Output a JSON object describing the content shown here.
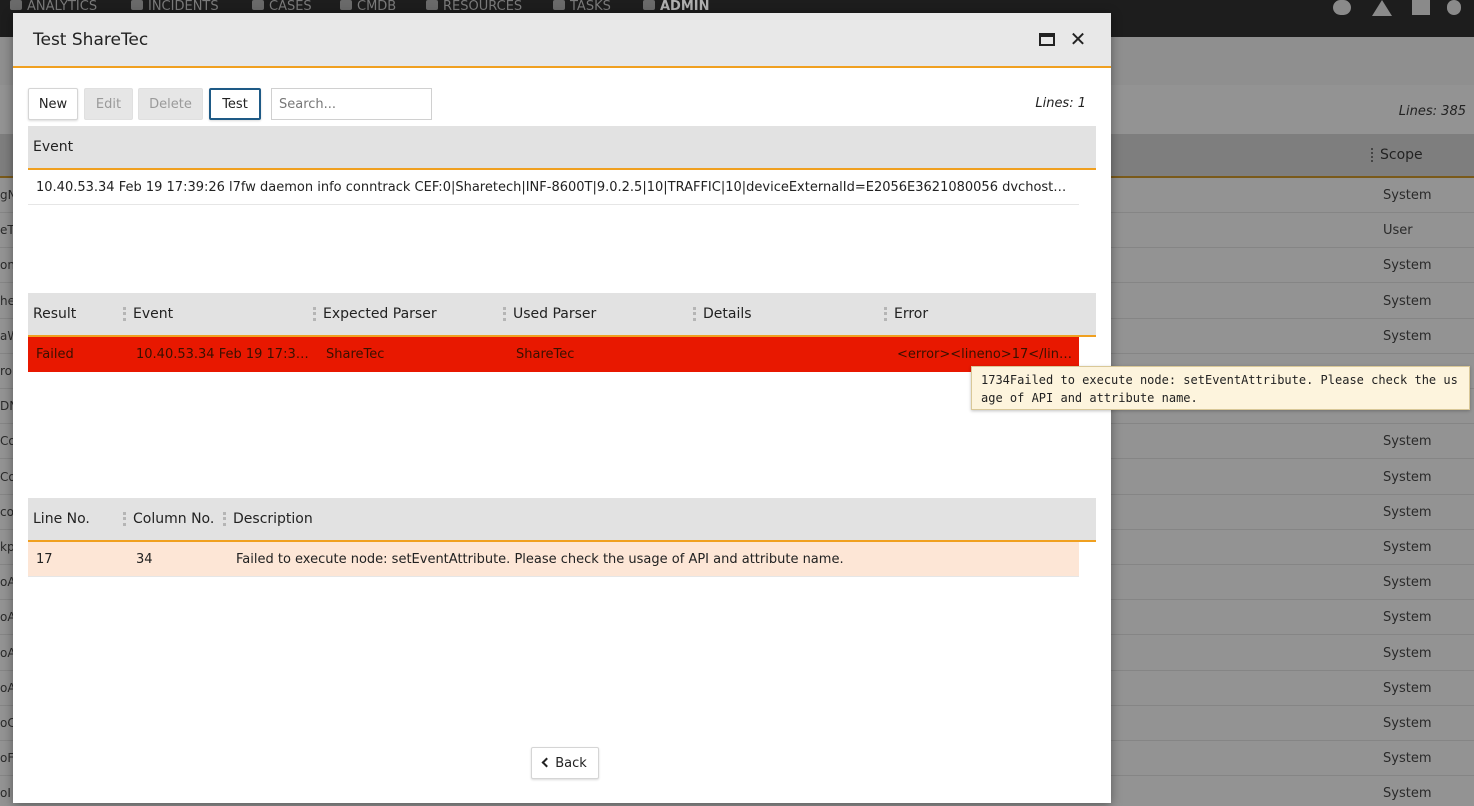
{
  "background": {
    "nav": [
      {
        "label": "ANALYTICS",
        "icon": "chart-icon",
        "active": false
      },
      {
        "label": "INCIDENTS",
        "icon": "bell-icon",
        "active": false
      },
      {
        "label": "CASES",
        "icon": "folder-icon",
        "active": false
      },
      {
        "label": "CMDB",
        "icon": "database-icon",
        "active": false
      },
      {
        "label": "RESOURCES",
        "icon": "bar-chart-icon",
        "active": false
      },
      {
        "label": "TASKS",
        "icon": "list-icon",
        "active": false
      },
      {
        "label": "ADMIN",
        "icon": "gears-icon",
        "active": true
      }
    ],
    "right_icons": [
      "help-icon",
      "warning-icon",
      "id-card-icon",
      "user-icon"
    ],
    "lines": "Lines: 385",
    "scope_header": "Scope",
    "rows": [
      {
        "left": "gN",
        "scope": "System"
      },
      {
        "left": "eT",
        "scope": "User"
      },
      {
        "left": "on",
        "scope": "System"
      },
      {
        "left": "he",
        "scope": "System"
      },
      {
        "left": "aW",
        "scope": "System"
      },
      {
        "left": "ro",
        "scope": ""
      },
      {
        "left": "DN",
        "scope": ""
      },
      {
        "left": "Co",
        "scope": "System"
      },
      {
        "left": "Co",
        "scope": "System"
      },
      {
        "left": "co",
        "scope": "System"
      },
      {
        "left": "kp",
        "scope": "System"
      },
      {
        "left": "oA",
        "scope": "System"
      },
      {
        "left": "oA",
        "scope": "System"
      },
      {
        "left": "oA",
        "scope": "System"
      },
      {
        "left": "oA",
        "scope": "System"
      },
      {
        "left": "oC",
        "scope": "System"
      },
      {
        "left": "oF",
        "scope": "System"
      },
      {
        "left": "oI",
        "scope": "System"
      }
    ]
  },
  "modal": {
    "title": "Test ShareTec",
    "toolbar": {
      "new_label": "New",
      "edit_label": "Edit",
      "delete_label": "Delete",
      "test_label": "Test",
      "search_placeholder": "Search...",
      "lines": "Lines: 1"
    },
    "event_grid": {
      "header": "Event",
      "rows": [
        "10.40.53.34 Feb 19 17:39:26 l7fw daemon info conntrack CEF:0|Sharetech|INF-8600T|9.0.2.5|10|TRAFFIC|10|deviceExternalId=E2056E3621080056 dvchost=INF-..."
      ]
    },
    "result_grid": {
      "headers": [
        "Result",
        "Event",
        "Expected Parser",
        "Used Parser",
        "Details",
        "Error"
      ],
      "rows": [
        {
          "result": "Failed",
          "event": "10.40.53.34 Feb 19 17:39...",
          "expected": "ShareTec",
          "used": "ShareTec",
          "details": "",
          "error": "<error><lineno>17</linen..."
        }
      ],
      "failed_color": "#e81800"
    },
    "tooltip": "1734Failed to execute node: setEventAttribute. Please check the usage of API and attribute name.",
    "error_grid": {
      "headers": [
        "Line No.",
        "Column No.",
        "Description"
      ],
      "rows": [
        {
          "line": "17",
          "column": "34",
          "description": "Failed to execute node: setEventAttribute. Please check the usage of API and attribute name."
        }
      ]
    },
    "back_label": "Back",
    "accent_color": "#f0a020"
  }
}
